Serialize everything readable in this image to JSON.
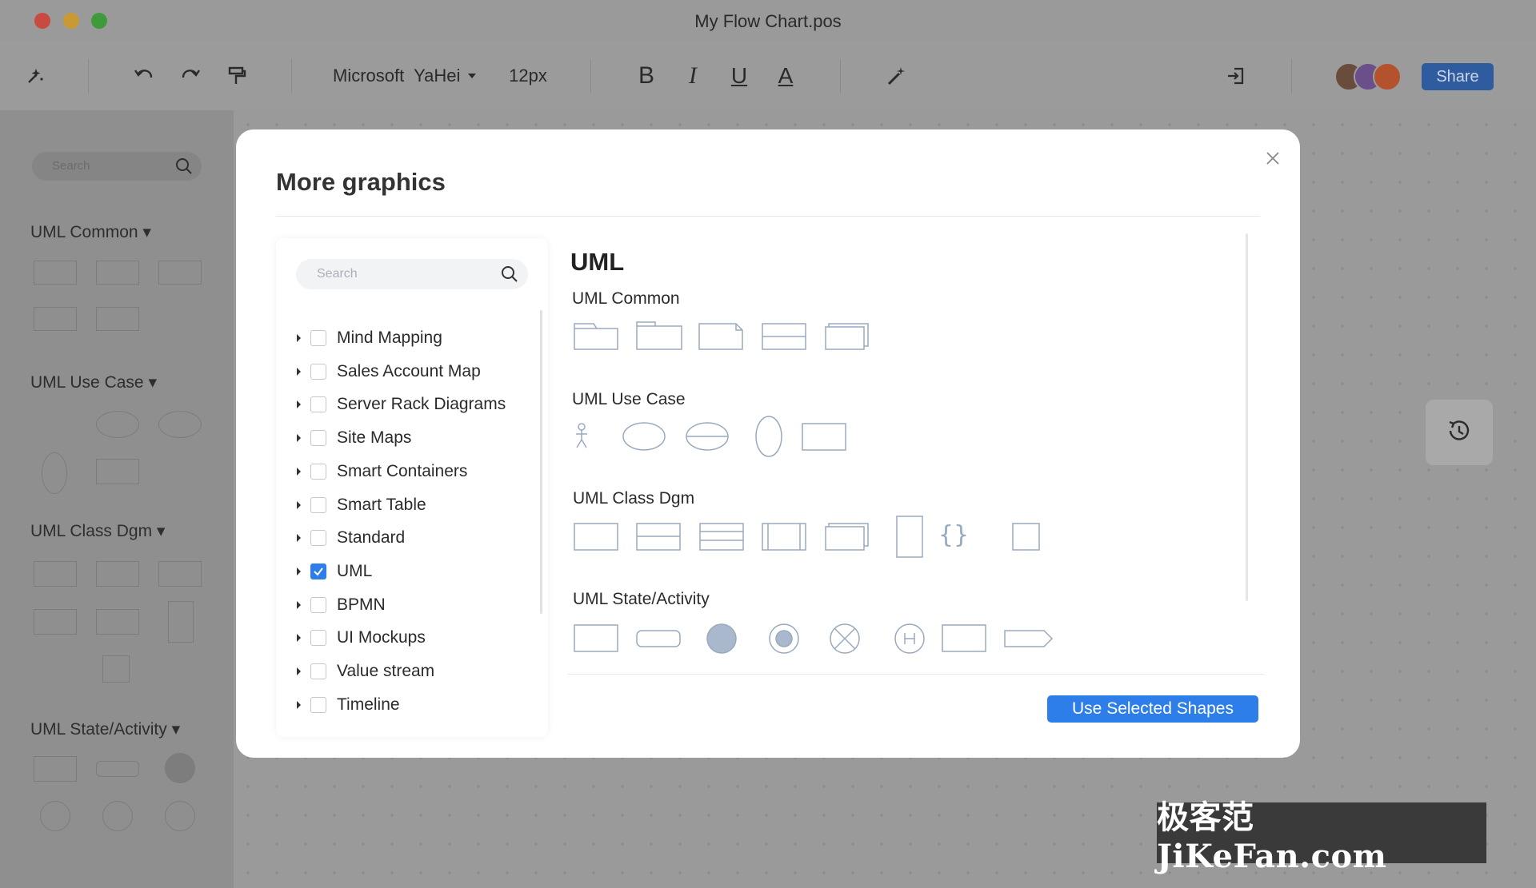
{
  "window": {
    "title": "My Flow Chart.pos"
  },
  "toolbar": {
    "font_name": "Microsoft  YaHei",
    "font_size": "12px",
    "bold": "B",
    "italic": "I",
    "underline": "U",
    "font_color": "A",
    "share_label": "Share"
  },
  "sidebar": {
    "search_placeholder": "Search",
    "sections": [
      "UML Common",
      "UML Use Case",
      "UML Class Dgm",
      "UML State/Activity"
    ]
  },
  "modal": {
    "title": "More graphics",
    "search_placeholder": "Search",
    "categories": [
      {
        "label": "Mind Mapping",
        "checked": false
      },
      {
        "label": "Sales Account Map",
        "checked": false
      },
      {
        "label": "Server Rack Diagrams",
        "checked": false
      },
      {
        "label": "Site Maps",
        "checked": false
      },
      {
        "label": "Smart Containers",
        "checked": false
      },
      {
        "label": "Smart Table",
        "checked": false
      },
      {
        "label": "Standard",
        "checked": false
      },
      {
        "label": "UML",
        "checked": true
      },
      {
        "label": "BPMN",
        "checked": false
      },
      {
        "label": "UI Mockups",
        "checked": false
      },
      {
        "label": "Value stream",
        "checked": false
      },
      {
        "label": "Timeline",
        "checked": false
      }
    ],
    "library_title": "UML",
    "groups": [
      "UML Common",
      "UML Use Case",
      "UML Class Dgm",
      "UML State/Activity"
    ],
    "use_button": "Use Selected Shapes"
  },
  "watermark": "极客范 JiKeFan.com",
  "colors": {
    "accent": "#2d7ee8",
    "share": "#2f5c9e",
    "shape_stroke": "#9aaabd",
    "shape_fill": "#a9b8cc"
  }
}
